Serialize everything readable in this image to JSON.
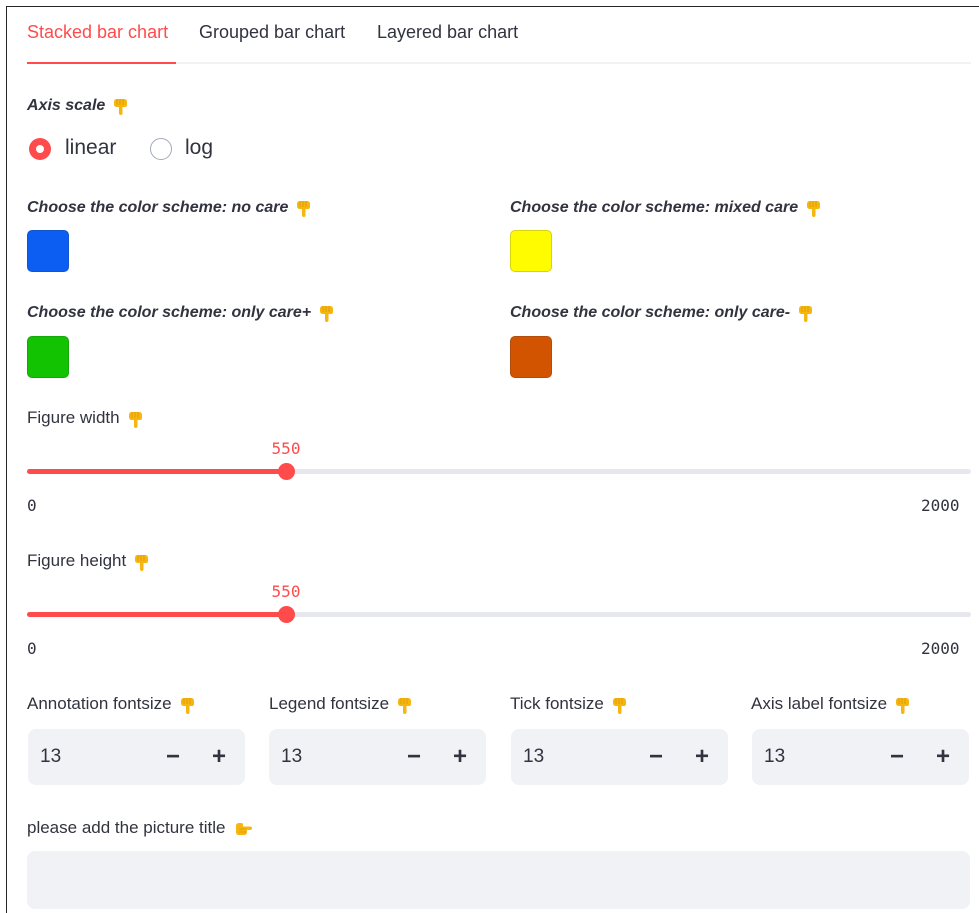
{
  "tabs": [
    {
      "label": "Stacked bar chart",
      "active": true
    },
    {
      "label": "Grouped bar chart",
      "active": false
    },
    {
      "label": "Layered bar chart",
      "active": false
    }
  ],
  "axis_scale": {
    "label": "Axis scale",
    "icon": "point-down-icon",
    "options": [
      "linear",
      "log"
    ],
    "selected": "linear"
  },
  "color_pickers": [
    {
      "label": "Choose the color scheme: no care",
      "color": "#0c5ef3"
    },
    {
      "label": "Choose the color scheme: mixed care",
      "color": "#fffc00"
    },
    {
      "label": "Choose the color scheme: only care+",
      "color": "#12c302"
    },
    {
      "label": "Choose the color scheme: only care-",
      "color": "#d35400"
    }
  ],
  "sliders": [
    {
      "label": "Figure width",
      "value": "550",
      "min": "0",
      "max": "2000"
    },
    {
      "label": "Figure height",
      "value": "550",
      "min": "0",
      "max": "2000"
    }
  ],
  "fontsizes": [
    {
      "label": "Annotation fontsize",
      "value": "13"
    },
    {
      "label": "Legend fontsize",
      "value": "13"
    },
    {
      "label": "Tick fontsize",
      "value": "13"
    },
    {
      "label": "Axis label fontsize",
      "value": "13"
    }
  ],
  "stepper": {
    "minus": "−",
    "plus": "+"
  },
  "picture_title": {
    "label": "please add the picture title",
    "icon": "point-left-icon",
    "value": ""
  },
  "colors": {
    "accent": "#ff4b4b",
    "emoji": "#f4b400",
    "input_bg": "#f0f2f6"
  }
}
